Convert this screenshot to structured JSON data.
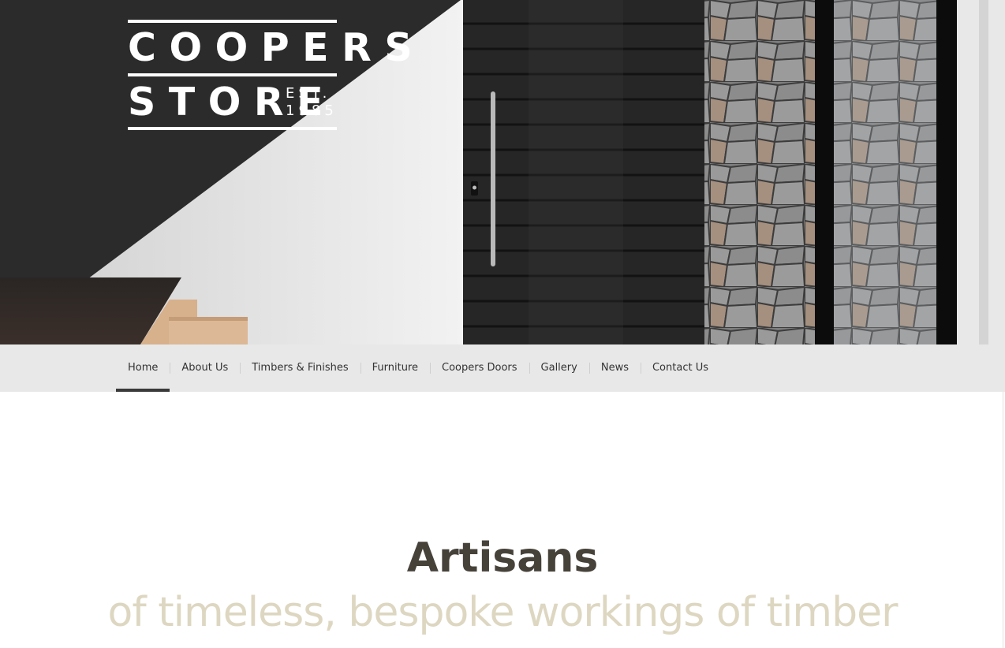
{
  "logo": {
    "line1": "COOPERS",
    "line2": "STORE",
    "est_label": "EST.",
    "est_year": "1985"
  },
  "hero": {
    "colors": {
      "wall_dark": "#2b2b2c",
      "wall_light": "#e6e6e6",
      "door": "#262626",
      "stone": "#8a8a8a",
      "timber": "#d9b594"
    }
  },
  "nav": {
    "items": [
      {
        "label": "Home",
        "active": true
      },
      {
        "label": "About Us"
      },
      {
        "label": "Timbers & Finishes"
      },
      {
        "label": "Furniture"
      },
      {
        "label": "Coopers Doors"
      },
      {
        "label": "Gallery"
      },
      {
        "label": "News"
      },
      {
        "label": "Contact Us"
      }
    ]
  },
  "main": {
    "headline": "Artisans",
    "tagline": "of timeless, bespoke workings of timber"
  }
}
